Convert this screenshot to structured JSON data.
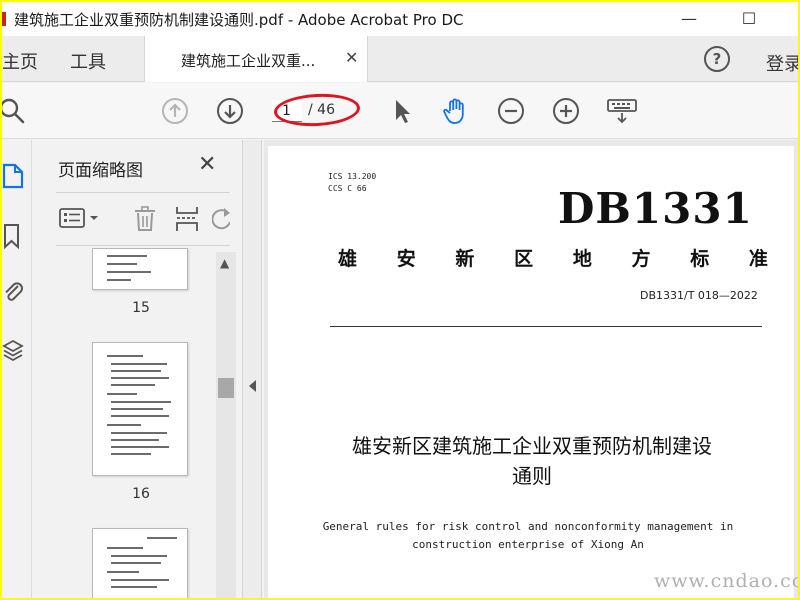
{
  "window": {
    "title": "建筑施工企业双重预防机制建设通则.pdf - Adobe Acrobat Pro DC",
    "minimize_glyph": "—",
    "maximize_glyph": "☐"
  },
  "tabs": {
    "home": "主页",
    "tools": "工具",
    "document": "建筑施工企业双重...",
    "close_glyph": "✕",
    "help_glyph": "?",
    "login": "登录"
  },
  "toolbar": {
    "icons": [
      "search-icon",
      "page-up-icon",
      "page-down-icon",
      "select-cursor-icon",
      "hand-tool-icon",
      "zoom-out-icon",
      "zoom-in-icon",
      "keyboard-icon"
    ],
    "page_current": "1",
    "page_total": "/ 46",
    "highlight_color": "#e0141e"
  },
  "thumbnail_panel": {
    "title": "页面缩略图",
    "close_glyph": "✕",
    "thumbnails": [
      {
        "label": "15"
      },
      {
        "label": "16"
      },
      {
        "label": ""
      }
    ]
  },
  "document": {
    "ics": "ICS 13.200",
    "ccs": "CCS C 66",
    "code": "DB1331",
    "standard_type_chars": [
      "雄",
      "安",
      "新",
      "区",
      "地",
      "方",
      "标",
      "准"
    ],
    "standard_number": "DB1331/T 018—2022",
    "title_line1": "雄安新区建筑施工企业双重预防机制建设",
    "title_line2": "通则",
    "english_line1": "General rules for risk control and nonconformity management in",
    "english_line2": "construction enterprise of Xiong An"
  },
  "watermark": "www.cndao.com",
  "colors": {
    "accent_blue": "#1473e6",
    "frame_yellow": "#ffff00"
  }
}
